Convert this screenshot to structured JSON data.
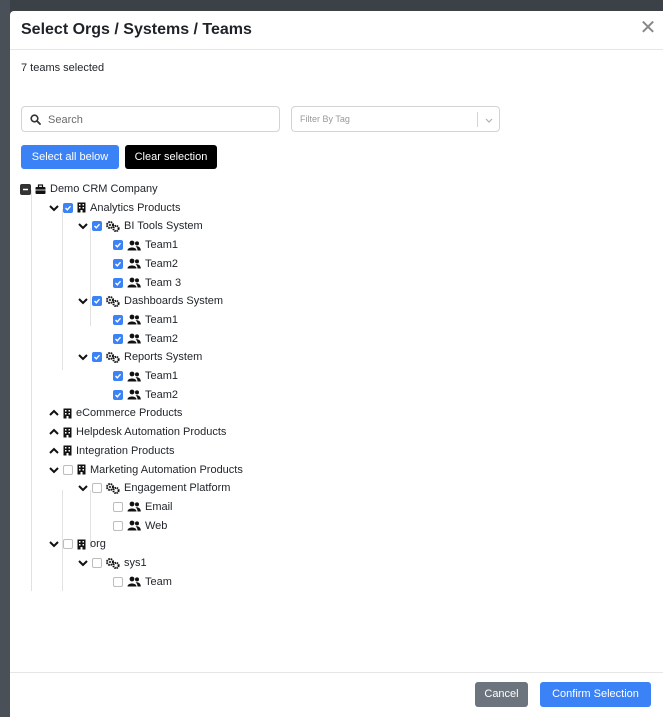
{
  "modal": {
    "title": "Select Orgs / Systems / Teams",
    "selection_count": "7 teams selected"
  },
  "search": {
    "placeholder": "Search"
  },
  "filter": {
    "placeholder": "Filter By Tag"
  },
  "actions": {
    "select_all": "Select all below",
    "clear": "Clear selection"
  },
  "tree": [
    {
      "kind": "company",
      "label": "Demo CRM Company",
      "state": "partial",
      "expander": "none"
    },
    {
      "kind": "org",
      "label": "Analytics Products",
      "state": "checked",
      "expander": "expanded"
    },
    {
      "kind": "system",
      "label": "BI Tools System",
      "state": "checked",
      "expander": "expanded"
    },
    {
      "kind": "team",
      "label": "Team1",
      "state": "checked"
    },
    {
      "kind": "team",
      "label": "Team2",
      "state": "checked"
    },
    {
      "kind": "team",
      "label": "Team 3",
      "state": "checked"
    },
    {
      "kind": "system",
      "label": "Dashboards System",
      "state": "checked",
      "expander": "expanded"
    },
    {
      "kind": "team",
      "label": "Team1",
      "state": "checked"
    },
    {
      "kind": "team",
      "label": "Team2",
      "state": "checked"
    },
    {
      "kind": "system",
      "label": "Reports System",
      "state": "checked",
      "expander": "expanded"
    },
    {
      "kind": "team",
      "label": "Team1",
      "state": "checked"
    },
    {
      "kind": "team",
      "label": "Team2",
      "state": "checked"
    },
    {
      "kind": "org",
      "label": "eCommerce Products",
      "state": "none",
      "expander": "collapsed"
    },
    {
      "kind": "org",
      "label": "Helpdesk Automation Products",
      "state": "none",
      "expander": "collapsed"
    },
    {
      "kind": "org",
      "label": "Integration Products",
      "state": "none",
      "expander": "collapsed"
    },
    {
      "kind": "org",
      "label": "Marketing Automation Products",
      "state": "unchecked",
      "expander": "expanded"
    },
    {
      "kind": "system",
      "label": "Engagement Platform",
      "state": "unchecked",
      "expander": "expanded"
    },
    {
      "kind": "team",
      "label": "Email",
      "state": "unchecked"
    },
    {
      "kind": "team",
      "label": "Web",
      "state": "unchecked"
    },
    {
      "kind": "org",
      "label": "org",
      "state": "unchecked",
      "expander": "expanded"
    },
    {
      "kind": "system",
      "label": "sys1",
      "state": "unchecked",
      "expander": "expanded"
    },
    {
      "kind": "team",
      "label": "Team",
      "state": "unchecked"
    }
  ],
  "footer": {
    "cancel": "Cancel",
    "confirm": "Confirm Selection"
  },
  "colors": {
    "primary": "#3b82f6",
    "dark": "#000000",
    "muted_button": "#6c757d"
  }
}
